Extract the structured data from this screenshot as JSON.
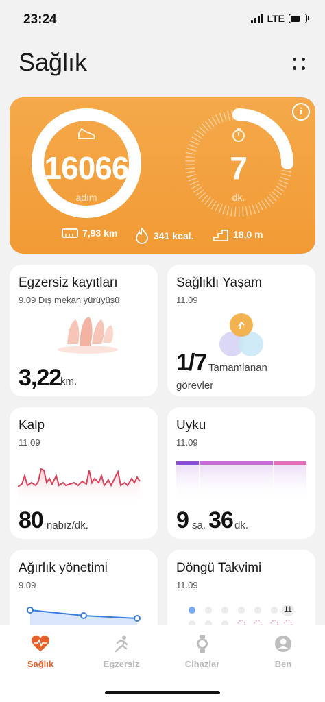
{
  "status_bar": {
    "time": "23:24",
    "network": "LTE"
  },
  "page": {
    "title": "Sağlık"
  },
  "summary": {
    "steps_value": "16066",
    "steps_unit": "adım",
    "steps_progress": 1.0,
    "minutes_value": "7",
    "minutes_unit": "dk.",
    "minutes_progress": 0.25,
    "distance": "7,93 km",
    "calories": "341 kcal.",
    "floors": "18,0 m",
    "info_glyph": "i"
  },
  "cards": {
    "exercise": {
      "title": "Egzersiz kayıtları",
      "subtitle": "9.09 Dış mekan yürüyüşü",
      "value": "3,22",
      "unit": "km."
    },
    "healthy_living": {
      "title": "Sağlıklı Yaşam",
      "subtitle": "11.09",
      "value": "1/7",
      "unit_line1": "Tamamlanan",
      "unit_line2": "görevler"
    },
    "heart": {
      "title": "Kalp",
      "subtitle": "11.09",
      "value": "80",
      "unit": "nabız/dk."
    },
    "sleep": {
      "title": "Uyku",
      "subtitle": "11.09",
      "hours": "9",
      "hours_unit": "sa.",
      "minutes": "36",
      "minutes_unit": "dk."
    },
    "weight": {
      "title": "Ağırlık yönetimi",
      "subtitle": "9.09"
    },
    "cycle": {
      "title": "Döngü Takvimi",
      "subtitle": "11.09",
      "day_badge": "11"
    }
  },
  "tabs": [
    {
      "label": "Sağlık",
      "icon": "heart-pulse-icon",
      "active": true
    },
    {
      "label": "Egzersiz",
      "icon": "running-icon",
      "active": false
    },
    {
      "label": "Cihazlar",
      "icon": "watch-icon",
      "active": false
    },
    {
      "label": "Ben",
      "icon": "profile-icon",
      "active": false
    }
  ],
  "colors": {
    "accent": "#f19a35",
    "tab_active": "#e5602a",
    "heart_line": "#d9435b",
    "sleep_bar": "#c86bd8",
    "weight_line": "#3b7ddd"
  }
}
